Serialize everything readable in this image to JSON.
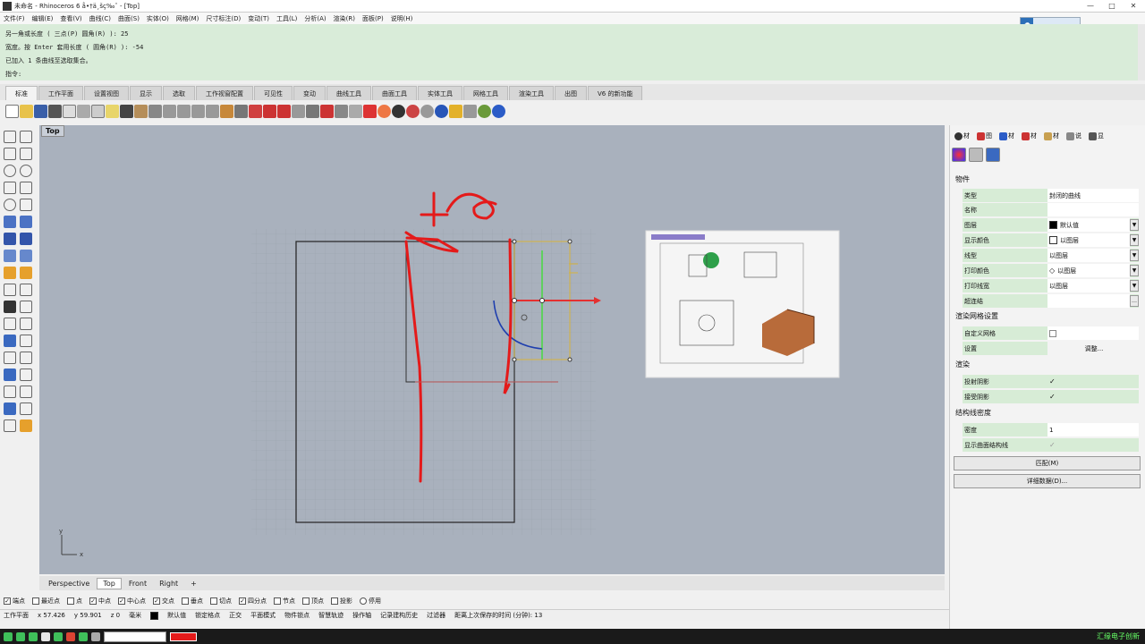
{
  "window": {
    "title": "未命名 - Rhinoceros 6 å•†ä¸šç‰ˆ - [Top]",
    "min": "—",
    "max": "□",
    "close": "✕"
  },
  "menu": [
    "文件(F)",
    "编辑(E)",
    "查看(V)",
    "曲线(C)",
    "曲面(S)",
    "实体(O)",
    "网格(M)",
    "尺寸标注(D)",
    "变动(T)",
    "工具(L)",
    "分析(A)",
    "渲染(R)",
    "面板(P)",
    "说明(H)"
  ],
  "command_history": [
    "另一角或长度 ( 三点(P)  圆角(R) ): 25",
    "宽度。按 Enter 套用长度 ( 圆角(R) ): -54",
    "已加入 1 条曲线至选取集合。",
    "指令:"
  ],
  "toolbar_tabs": [
    "标准",
    "工作平面",
    "设置视图",
    "显示",
    "选取",
    "工作视窗配置",
    "可见性",
    "变动",
    "曲线工具",
    "曲面工具",
    "实体工具",
    "网格工具",
    "渲染工具",
    "出图",
    "V6 的新功能"
  ],
  "active_toolbar_tab": "标准",
  "viewport": {
    "label": "Top",
    "axis_x": "x",
    "axis_y": "y"
  },
  "viewport_tabs": [
    "Perspective",
    "Top",
    "Front",
    "Right",
    "+"
  ],
  "snaps": [
    {
      "label": "端点",
      "checked": true
    },
    {
      "label": "最近点",
      "checked": false
    },
    {
      "label": "点",
      "checked": false
    },
    {
      "label": "中点",
      "checked": true
    },
    {
      "label": "中心点",
      "checked": true
    },
    {
      "label": "交点",
      "checked": true
    },
    {
      "label": "垂点",
      "checked": false
    },
    {
      "label": "切点",
      "checked": false
    },
    {
      "label": "四分点",
      "checked": true
    },
    {
      "label": "节点",
      "checked": false
    },
    {
      "label": "顶点",
      "checked": false
    },
    {
      "label": "投影",
      "checked": false
    },
    {
      "label": "停用",
      "checked": false
    }
  ],
  "status": {
    "cplane": "工作平面",
    "x": "x 57.426",
    "y": "y 59.901",
    "z": "z 0",
    "unit": "毫米",
    "layer": "默认值",
    "toggles": [
      "锁定格点",
      "正交",
      "平面模式",
      "物件锁点",
      "智慧轨迹",
      "操作轴",
      "记录建构历史",
      "过滤器"
    ],
    "save_msg": "距离上次保存的时间 (分钟): 13"
  },
  "panel": {
    "tabs": [
      "材",
      "图",
      "材",
      "材",
      "材",
      "说",
      "显"
    ],
    "section_object": "物件",
    "rows": [
      {
        "k": "类型",
        "v": "封闭的曲线"
      },
      {
        "k": "名称",
        "v": ""
      },
      {
        "k": "图层",
        "v": "默认值"
      },
      {
        "k": "显示颜色",
        "v": "以图层"
      },
      {
        "k": "线型",
        "v": "以图层"
      },
      {
        "k": "打印颜色",
        "v": "以图层"
      },
      {
        "k": "打印线宽",
        "v": "以图层"
      },
      {
        "k": "超连结",
        "v": ""
      }
    ],
    "section_render_mesh": "渲染网格设置",
    "custom_mesh": "自定义网格",
    "settings": "设置",
    "adjust_btn": "调整...",
    "section_render": "渲染",
    "cast_shadow": "投射阴影",
    "receive_shadow": "接受阴影",
    "section_iso": "结构线密度",
    "density": "密度",
    "density_val": "1",
    "show_iso": "显示曲面结构线",
    "match_btn": "匹配(M)",
    "details_btn": "详细数据(D)..."
  },
  "taskbar_right": "汇缘电子创新",
  "colors": {
    "cmd_bg": "#d9ecd9",
    "viewport_bg": "#a9b1bd",
    "annot_red": "#e41a1a",
    "panel_green": "#d7ecd6"
  }
}
